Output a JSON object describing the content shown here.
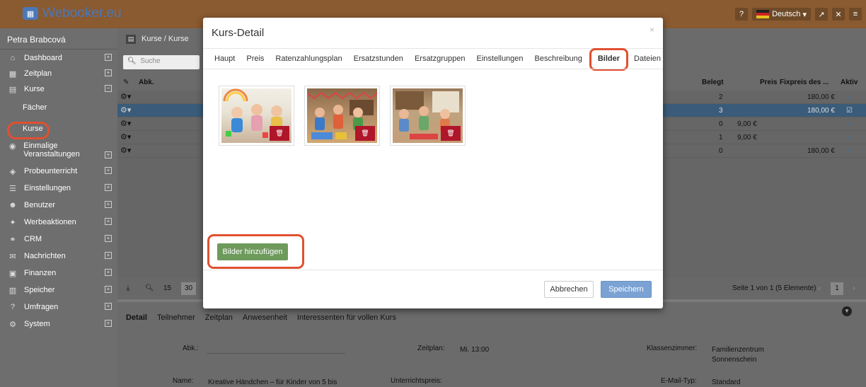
{
  "app": {
    "title": "Webooker.eu",
    "language": "Deutsch"
  },
  "sidebar": {
    "user": "Petra Brabcová",
    "items": [
      {
        "label": "Dashboard",
        "icon": "home-icon"
      },
      {
        "label": "Zeitplan",
        "icon": "calendar-icon"
      },
      {
        "label": "Kurse",
        "icon": "book-icon"
      },
      {
        "label": "Einmalige Veranstaltungen",
        "icon": "event-icon"
      },
      {
        "label": "Probeunterricht",
        "icon": "trial-icon"
      },
      {
        "label": "Einstellungen",
        "icon": "settings-icon"
      },
      {
        "label": "Benutzer",
        "icon": "users-icon"
      },
      {
        "label": "Werbeaktionen",
        "icon": "gift-icon"
      },
      {
        "label": "CRM",
        "icon": "crm-icon"
      },
      {
        "label": "Nachrichten",
        "icon": "mail-icon"
      },
      {
        "label": "Finanzen",
        "icon": "money-icon"
      },
      {
        "label": "Speicher",
        "icon": "storage-icon"
      },
      {
        "label": "Umfragen",
        "icon": "question-icon"
      },
      {
        "label": "System",
        "icon": "gears-icon"
      }
    ],
    "sub": [
      "Fächer",
      "Kurse"
    ]
  },
  "breadcrumb": "Kurse / Kurse",
  "search": {
    "placeholder": "Suche"
  },
  "grid": {
    "headers": {
      "abk": "Abk.",
      "belegt": "Belegt",
      "preis": "Preis",
      "fixpreis": "Fixpreis des ...",
      "aktiv": "Aktiv"
    },
    "rows": [
      {
        "belegt": "2",
        "preis": "",
        "fixpreis": "180,00 €",
        "aktiv": "✓"
      },
      {
        "belegt": "3",
        "preis": "",
        "fixpreis": "180,00 €",
        "aktiv": "☑"
      },
      {
        "belegt": "0",
        "preis": "9,00 €",
        "fixpreis": "",
        "aktiv": "✓"
      },
      {
        "belegt": "1",
        "preis": "9,00 €",
        "fixpreis": "",
        "aktiv": "✓"
      },
      {
        "belegt": "0",
        "preis": "",
        "fixpreis": "180,00 €",
        "aktiv": "✓"
      }
    ]
  },
  "pager": {
    "size15": "15",
    "size30": "30",
    "info": "Seite 1 von 1 (5 Elemente)",
    "page": "1"
  },
  "detail": {
    "tabs": [
      "Detail",
      "Teilnehmer",
      "Zeitplan",
      "Anwesenheit",
      "Interessenten für vollen Kurs"
    ],
    "abk_label": "Abk.:",
    "zeitplan_label": "Zeitplan:",
    "zeitplan_value": "Mi. 13:00",
    "klassenzimmer_label": "Klassenzimmer:",
    "klassenzimmer_value1": "Familienzentrum",
    "klassenzimmer_value2": "Sonnenschein",
    "name_label": "Name:",
    "name_value": "Kreative Händchen – für Kinder von 5 bis",
    "unterrichtspreis_label": "Unterrichtspreis:",
    "email_typ_label": "E-Mail-Typ:",
    "email_typ_value": "Standard"
  },
  "modal": {
    "title": "Kurs-Detail",
    "close": "×",
    "tabs": [
      "Haupt",
      "Preis",
      "Ratenzahlungsplan",
      "Ersatzstunden",
      "Ersatzgruppen",
      "Einstellungen",
      "Beschreibung",
      "Bilder",
      "Dateien"
    ],
    "active_tab": "Bilder",
    "add_images": "Bilder hinzufügen",
    "cancel": "Abbrechen",
    "save": "Speichern"
  }
}
